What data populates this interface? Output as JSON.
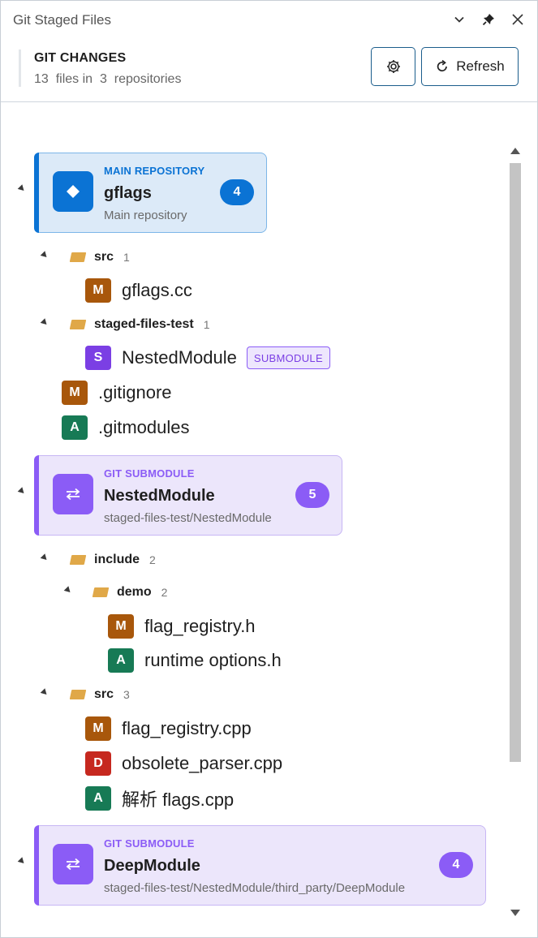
{
  "window": {
    "title": "Git Staged Files"
  },
  "icons": {
    "collapse": "chevron-down-icon",
    "pin": "pin-icon",
    "close": "close-icon",
    "settings": "gear-icon",
    "refresh": "refresh-icon"
  },
  "header": {
    "title": "GIT CHANGES",
    "file_count": "13",
    "files_label": "files in",
    "repo_count": "3",
    "repos_label": "repositories",
    "refresh_label": "Refresh"
  },
  "colors": {
    "main_repo_accent": "#0b73d4",
    "submodule_accent": "#8b5cf6",
    "modified": "#a8570b",
    "added": "#177a55",
    "deleted": "#c6281f",
    "submodule_status": "#7b3fe4"
  },
  "repos": [
    {
      "kind": "MAIN REPOSITORY",
      "name": "gflags",
      "path": "Main repository",
      "count": "4",
      "folders": [
        {
          "name": "src",
          "count": "1",
          "files": [
            {
              "status": "M",
              "name": "gflags.cc"
            }
          ]
        },
        {
          "name": "staged-files-test",
          "count": "1",
          "files": [
            {
              "status": "S",
              "name": "NestedModule",
              "tag": "SUBMODULE"
            }
          ]
        }
      ],
      "files": [
        {
          "status": "M",
          "name": ".gitignore"
        },
        {
          "status": "A",
          "name": ".gitmodules"
        }
      ]
    },
    {
      "kind": "GIT SUBMODULE",
      "name": "NestedModule",
      "path": "staged-files-test/NestedModule",
      "count": "5",
      "folders": [
        {
          "name": "include",
          "count": "2",
          "subfolders": [
            {
              "name": "demo",
              "count": "2",
              "files": [
                {
                  "status": "M",
                  "name": "flag_registry.h"
                },
                {
                  "status": "A",
                  "name": "runtime options.h"
                }
              ]
            }
          ]
        },
        {
          "name": "src",
          "count": "3",
          "files": [
            {
              "status": "M",
              "name": "flag_registry.cpp"
            },
            {
              "status": "D",
              "name": "obsolete_parser.cpp"
            },
            {
              "status": "A",
              "name": "解析 flags.cpp"
            }
          ]
        }
      ]
    },
    {
      "kind": "GIT SUBMODULE",
      "name": "DeepModule",
      "path": "staged-files-test/NestedModule/third_party/DeepModule",
      "count": "4"
    }
  ]
}
